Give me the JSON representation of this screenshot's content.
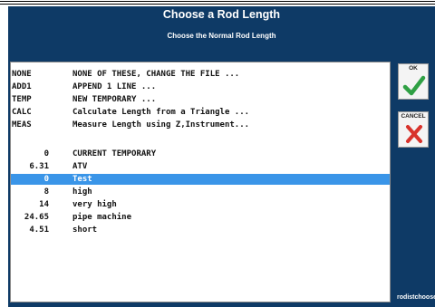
{
  "dialog": {
    "title": "Choose a Rod Length",
    "subtitle": "Choose the Normal Rod Length",
    "footer": "rodistchoose"
  },
  "colors": {
    "background": "#0e3a66",
    "selection": "#3a95e8",
    "ok_check": "#2fa044",
    "cancel_x": "#d8322b"
  },
  "buttons": {
    "ok_label": "OK",
    "cancel_label": "CANCEL"
  },
  "options": [
    {
      "code": "NONE",
      "description": "NONE OF THESE, CHANGE THE FILE ..."
    },
    {
      "code": "ADD1",
      "description": "APPEND 1 LINE ..."
    },
    {
      "code": "TEMP",
      "description": "NEW TEMPORARY ..."
    },
    {
      "code": "CALC",
      "description": "Calculate Length from a Triangle ..."
    },
    {
      "code": "MEAS",
      "description": "Measure Length using Z,Instrument..."
    }
  ],
  "lengths": [
    {
      "value": "0",
      "name": "CURRENT TEMPORARY"
    },
    {
      "value": "6.31",
      "name": "ATV"
    },
    {
      "value": "0",
      "name": "Test",
      "selected": true
    },
    {
      "value": "8",
      "name": "high"
    },
    {
      "value": "14",
      "name": "very high"
    },
    {
      "value": "24.65",
      "name": "pipe machine"
    },
    {
      "value": "4.51",
      "name": "short"
    }
  ]
}
